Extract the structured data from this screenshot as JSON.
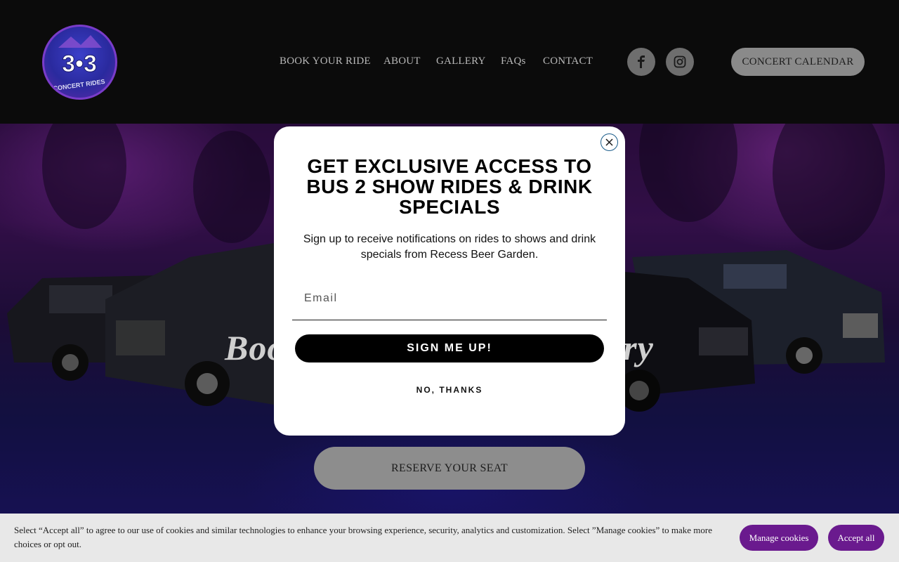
{
  "header": {
    "logo": {
      "text": "3•3",
      "subtext": "CONCERT RIDES"
    },
    "nav": [
      "BOOK YOUR RIDE",
      "ABOUT",
      "GALLERY",
      "FAQs",
      "CONTACT"
    ],
    "social": [
      {
        "icon": "facebook-icon"
      },
      {
        "icon": "instagram-icon"
      }
    ],
    "calendar_button": "CONCERT CALENDAR"
  },
  "hero": {
    "title_left": "Boo",
    "title_right": "ury",
    "reserve_button": "RESERVE YOUR SEAT"
  },
  "modal": {
    "title": "GET EXCLUSIVE ACCESS TO BUS 2 SHOW RIDES & DRINK SPECIALS",
    "text": "Sign up to receive notifications on rides to shows and drink specials from Recess Beer Garden.",
    "email_placeholder": "Email",
    "signup_button": "SIGN ME UP!",
    "decline_button": "NO, THANKS"
  },
  "cookie_bar": {
    "text": "Select “Accept all” to agree to our use of cookies and similar technologies to enhance your browsing experience, security, analytics and customization. Select ”Manage cookies” to make more choices or opt out.",
    "manage_button": "Manage cookies",
    "accept_button": "Accept all"
  },
  "colors": {
    "header_bg": "#0b0b0b",
    "accent_purple": "#6a1a8e",
    "modal_bg": "#ffffff",
    "button_gray": "#8a8a8a"
  }
}
